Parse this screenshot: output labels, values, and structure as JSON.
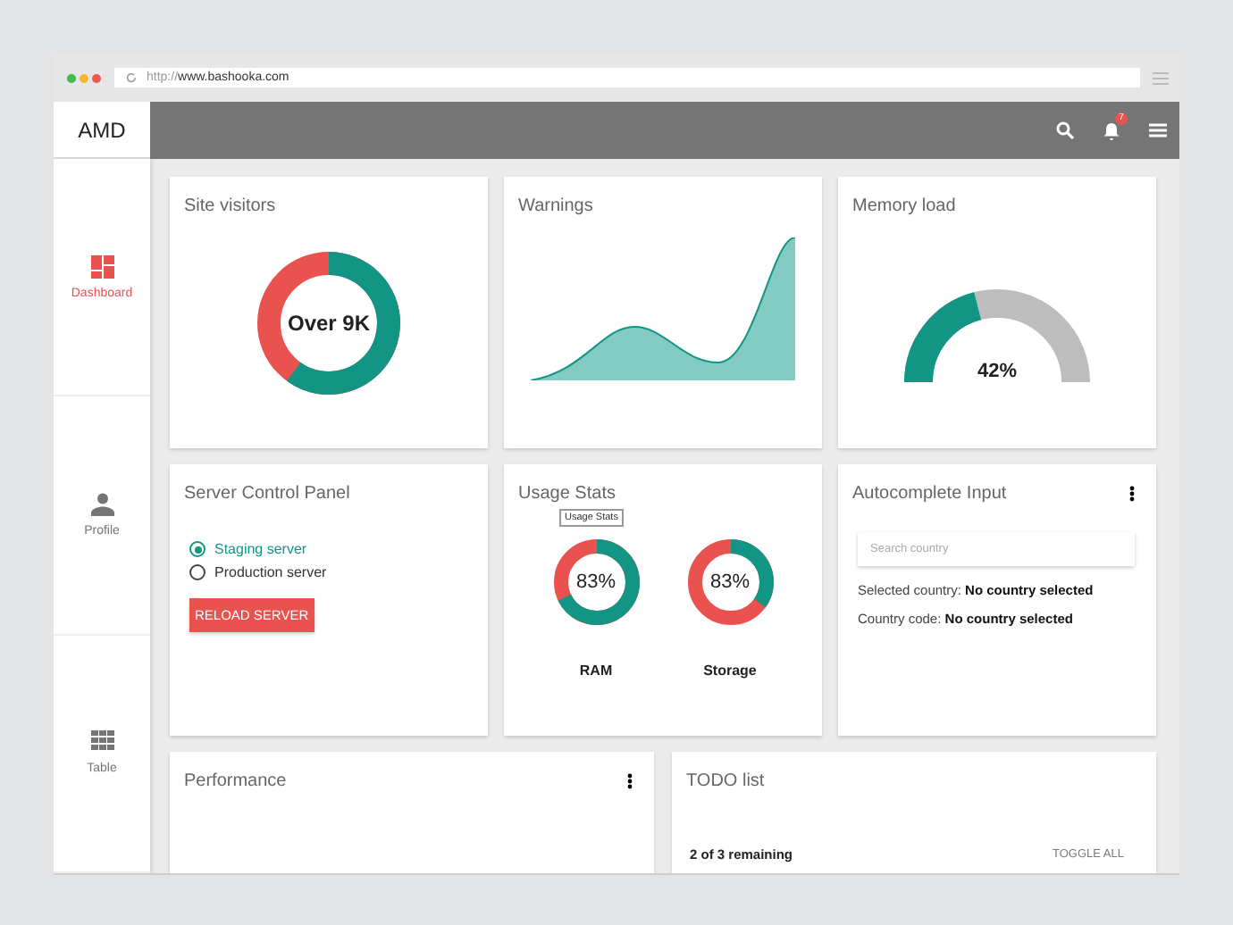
{
  "browser": {
    "url_scheme": "http://",
    "url_host": "www.bashooka.com"
  },
  "app_bar": {
    "brand": "AMD",
    "notification_count": "7"
  },
  "sidebar": {
    "items": [
      {
        "label": "Dashboard",
        "selected": true
      },
      {
        "label": "Profile",
        "selected": false
      },
      {
        "label": "Table",
        "selected": false
      }
    ]
  },
  "cards": [
    {
      "kind": "donut",
      "title": "Site visitors",
      "center_text": "Over 9K"
    },
    {
      "kind": "area",
      "title": "Warnings"
    },
    {
      "kind": "gauge",
      "title": "Memory load",
      "reading": "42%",
      "level": 0.42
    },
    {
      "kind": "radios",
      "title": "Server Control Panel",
      "options": [
        {
          "label": "Staging server",
          "selected": true
        },
        {
          "label": "Production server",
          "selected": false
        }
      ],
      "button": "RELOAD SERVER"
    },
    {
      "kind": "donuts",
      "title": "Usage Stats",
      "tooltip": "Usage Stats",
      "items": [
        {
          "label": "RAM",
          "reading": "83%"
        },
        {
          "label": "Storage",
          "reading": "83%"
        }
      ]
    },
    {
      "kind": "autocomplete",
      "title": "Autocomplete Input",
      "menu": true,
      "placeholder": "Search country",
      "lines": [
        {
          "label": "Selected country:",
          "value": "No country selected"
        },
        {
          "label": "Country code:",
          "value": "No country selected"
        }
      ]
    },
    {
      "kind": "performance",
      "title": "Performance",
      "menu": true
    },
    {
      "kind": "todo",
      "title": "TODO list",
      "remaining": "2 of 3 remaining",
      "toggle": "TOGGLE ALL"
    }
  ]
}
